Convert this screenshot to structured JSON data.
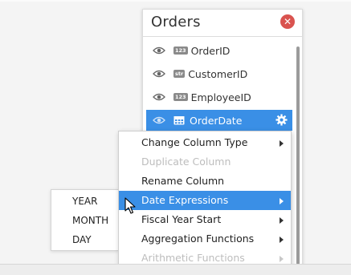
{
  "panel": {
    "title": "Orders",
    "fields": [
      {
        "label": "OrderID",
        "type_badge": "123",
        "icon": "eye-icon"
      },
      {
        "label": "CustomerID",
        "type_badge": "str",
        "icon": "eye-icon"
      },
      {
        "label": "EmployeeID",
        "type_badge": "123",
        "icon": "eye-icon"
      },
      {
        "label": "OrderDate",
        "type_badge": "calendar-icon",
        "icon": "eye-icon",
        "selected": true
      }
    ]
  },
  "context_menu": {
    "items": [
      {
        "label": "Change Column Type",
        "submenu": true,
        "disabled": false
      },
      {
        "label": "Duplicate Column",
        "submenu": false,
        "disabled": true
      },
      {
        "label": "Rename Column",
        "submenu": false,
        "disabled": false
      },
      {
        "label": "Date Expressions",
        "submenu": true,
        "disabled": false,
        "highlighted": true
      },
      {
        "label": "Fiscal Year Start",
        "submenu": true,
        "disabled": false
      },
      {
        "label": "Aggregation Functions",
        "submenu": true,
        "disabled": false
      },
      {
        "label": "Arithmetic Functions",
        "submenu": true,
        "disabled": true
      }
    ]
  },
  "submenu": {
    "items": [
      "YEAR",
      "MONTH",
      "DAY"
    ]
  },
  "colors": {
    "accent": "#3a8fe6",
    "close": "#d9534f"
  }
}
